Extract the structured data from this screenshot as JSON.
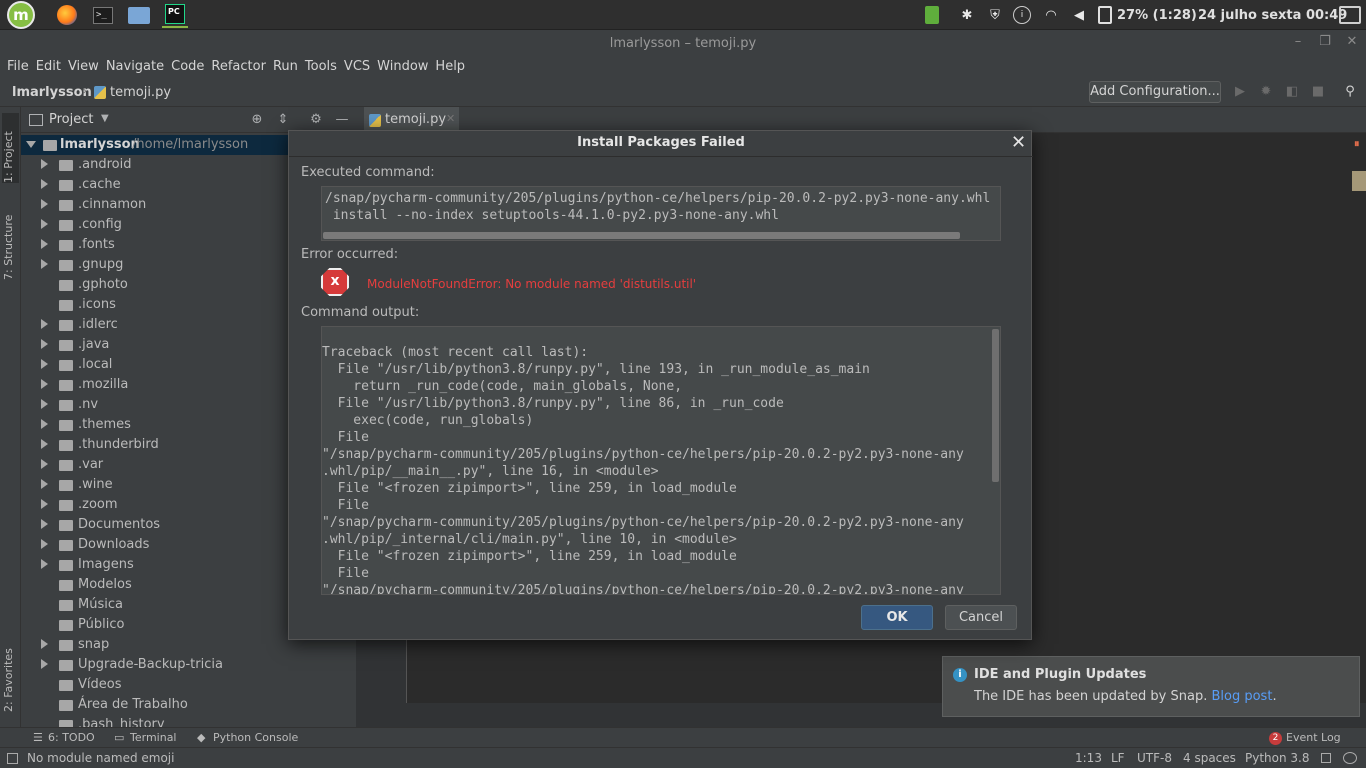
{
  "os_panel": {
    "battery": "27% (1:28)",
    "datetime": "24 julho sexta 00:49",
    "launchers": [
      "mint-menu",
      "firefox",
      "terminal",
      "files",
      "pycharm"
    ]
  },
  "window": {
    "title": "lmarlysson – temoji.py"
  },
  "menu": [
    "File",
    "Edit",
    "View",
    "Navigate",
    "Code",
    "Refactor",
    "Run",
    "Tools",
    "VCS",
    "Window",
    "Help"
  ],
  "nav": {
    "root": "lmarlysson",
    "file": "temoji.py",
    "add_config": "Add Configuration..."
  },
  "left_stripe": {
    "project": "1: Project",
    "structure": "7: Structure",
    "favorites": "2: Favorites"
  },
  "project_panel": {
    "title": "Project",
    "root_name": "lmarlysson",
    "root_path": "/home/lmarlysson",
    "items": [
      {
        "name": ".android",
        "expandable": true
      },
      {
        "name": ".cache",
        "expandable": true
      },
      {
        "name": ".cinnamon",
        "expandable": true
      },
      {
        "name": ".config",
        "expandable": true
      },
      {
        "name": ".fonts",
        "expandable": true
      },
      {
        "name": ".gnupg",
        "expandable": true
      },
      {
        "name": ".gphoto",
        "expandable": false
      },
      {
        "name": ".icons",
        "expandable": false
      },
      {
        "name": ".idlerc",
        "expandable": true
      },
      {
        "name": ".java",
        "expandable": true
      },
      {
        "name": ".local",
        "expandable": true
      },
      {
        "name": ".mozilla",
        "expandable": true
      },
      {
        "name": ".nv",
        "expandable": true
      },
      {
        "name": ".themes",
        "expandable": true
      },
      {
        "name": ".thunderbird",
        "expandable": true
      },
      {
        "name": ".var",
        "expandable": true
      },
      {
        "name": ".wine",
        "expandable": true
      },
      {
        "name": ".zoom",
        "expandable": true
      },
      {
        "name": "Documentos",
        "expandable": true
      },
      {
        "name": "Downloads",
        "expandable": true
      },
      {
        "name": "Imagens",
        "expandable": true
      },
      {
        "name": "Modelos",
        "expandable": false
      },
      {
        "name": "Música",
        "expandable": false
      },
      {
        "name": "Público",
        "expandable": false
      },
      {
        "name": "snap",
        "expandable": true
      },
      {
        "name": "Upgrade-Backup-tricia",
        "expandable": true
      },
      {
        "name": "Vídeos",
        "expandable": false
      },
      {
        "name": "Área de Trabalho",
        "expandable": false
      },
      {
        "name": ".bash_history",
        "expandable": false
      }
    ]
  },
  "editor": {
    "tab_label": "temoji.py"
  },
  "dialog": {
    "title": "Install Packages Failed",
    "executed_label": "Executed command:",
    "executed_command": "/snap/pycharm-community/205/plugins/python-ce/helpers/pip-20.0.2-py2.py3-none-any.whl\n install --no-index setuptools-44.1.0-py2.py3-none-any.whl",
    "error_label": "Error occurred:",
    "error_message": "ModuleNotFoundError: No module named 'distutils.util'",
    "output_label": "Command output:",
    "command_output": "Traceback (most recent call last):\n  File \"/usr/lib/python3.8/runpy.py\", line 193, in _run_module_as_main\n    return _run_code(code, main_globals, None,\n  File \"/usr/lib/python3.8/runpy.py\", line 86, in _run_code\n    exec(code, run_globals)\n  File\n\"/snap/pycharm-community/205/plugins/python-ce/helpers/pip-20.0.2-py2.py3-none-any\n.whl/pip/__main__.py\", line 16, in <module>\n  File \"<frozen zipimport>\", line 259, in load_module\n  File\n\"/snap/pycharm-community/205/plugins/python-ce/helpers/pip-20.0.2-py2.py3-none-any\n.whl/pip/_internal/cli/main.py\", line 10, in <module>\n  File \"<frozen zipimport>\", line 259, in load_module\n  File\n\"/snap/pycharm-community/205/plugins/python-ce/helpers/pip-20.0.2-py2.py3-none-any",
    "ok_label": "OK",
    "cancel_label": "Cancel"
  },
  "notification": {
    "title": "IDE and Plugin Updates",
    "body": "The IDE has been updated by Snap.",
    "link": "Blog post",
    "link_suffix": "."
  },
  "bottom_tools": {
    "todo": "6: TODO",
    "terminal": "Terminal",
    "python_console": "Python Console",
    "event_log": "Event Log",
    "event_count": "2"
  },
  "status_bar": {
    "message": "No module named emoji",
    "position": "1:13",
    "line_sep": "LF",
    "encoding": "UTF-8",
    "indent": "4 spaces",
    "interpreter": "Python 3.8"
  }
}
